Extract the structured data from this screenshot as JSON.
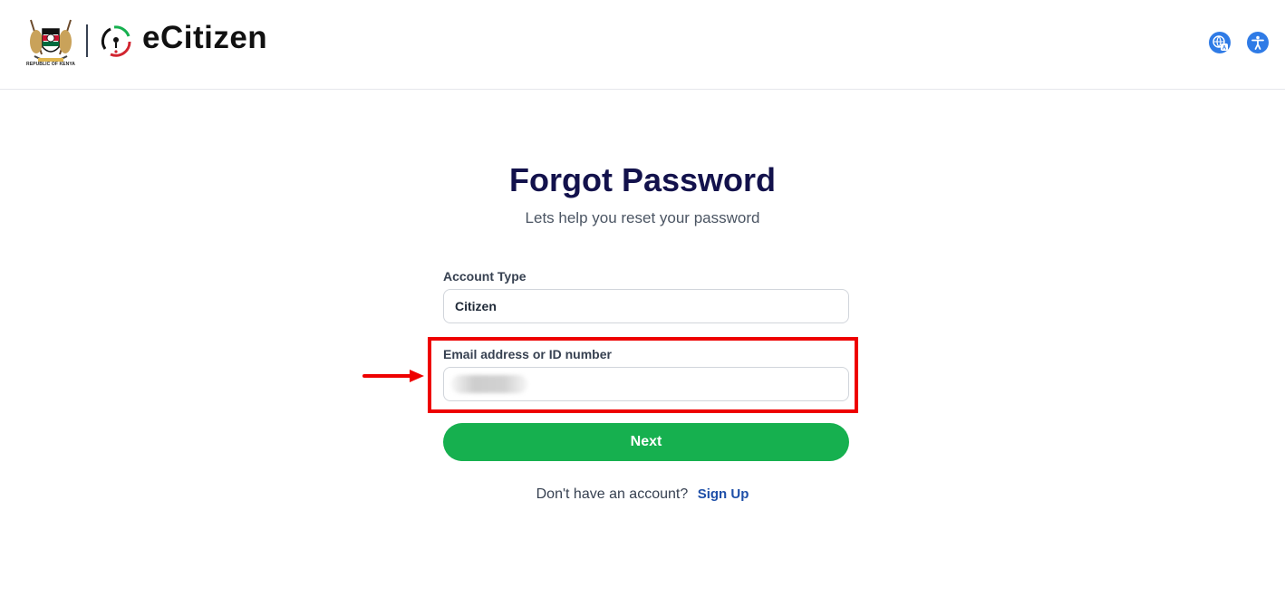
{
  "header": {
    "coat_caption": "REPUBLIC OF KENYA",
    "brand": "eCitizen",
    "icons": [
      "translate-icon",
      "accessibility-icon"
    ]
  },
  "page": {
    "title": "Forgot Password",
    "subtitle": "Lets help you reset your password"
  },
  "form": {
    "account_type_label": "Account Type",
    "account_type_value": "Citizen",
    "email_label": "Email address or ID number",
    "email_value": "",
    "next_label": "Next"
  },
  "footer": {
    "prompt": "Don't have an account?",
    "signup_label": "Sign Up"
  },
  "colors": {
    "primary_green": "#16b04f",
    "title_navy": "#13124c",
    "link_blue": "#1e4fa8",
    "highlight_red": "#ee0000",
    "icon_blue": "#2f7be6"
  }
}
